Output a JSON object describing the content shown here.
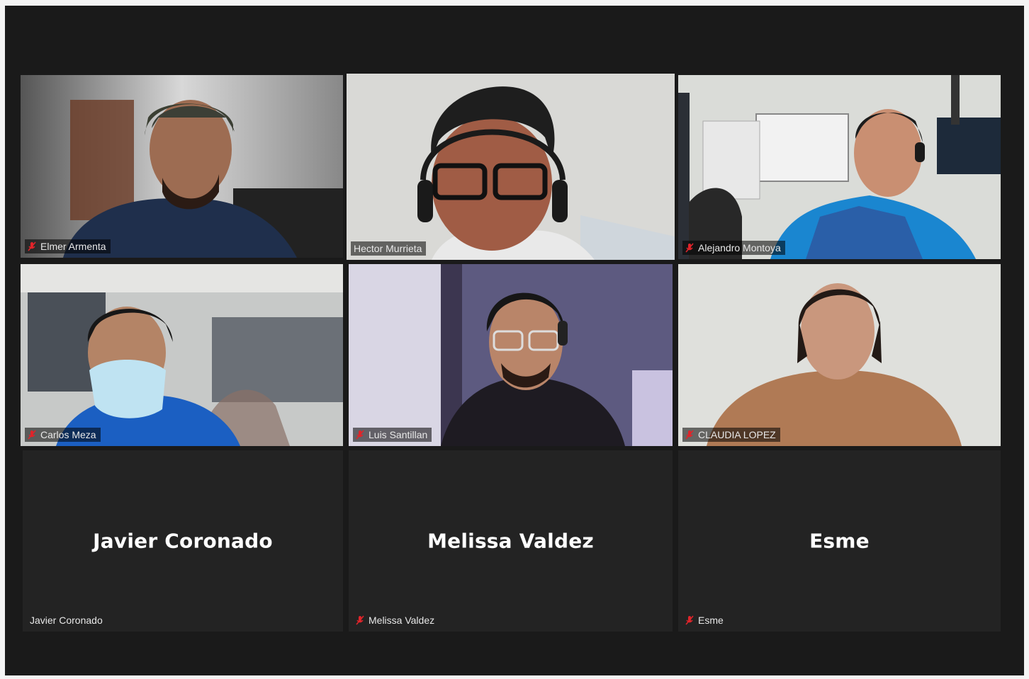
{
  "participants": [
    {
      "name": "Elmer Armenta",
      "video": true,
      "muted": true,
      "speaking": false
    },
    {
      "name": "Hector Murrieta",
      "video": true,
      "muted": false,
      "speaking": true
    },
    {
      "name": "Alejandro Montoya",
      "video": true,
      "muted": true,
      "speaking": false
    },
    {
      "name": "Carlos Meza",
      "video": true,
      "muted": true,
      "speaking": false
    },
    {
      "name": "Luis Santillan",
      "video": true,
      "muted": true,
      "speaking": false
    },
    {
      "name": "CLAUDIA LOPEZ",
      "video": true,
      "muted": true,
      "speaking": false
    },
    {
      "name": "Javier Coronado",
      "video": false,
      "muted": false,
      "speaking": false
    },
    {
      "name": "Melissa Valdez",
      "video": false,
      "muted": true,
      "speaking": false
    },
    {
      "name": "Esme",
      "video": false,
      "muted": true,
      "speaking": false
    }
  ],
  "colors": {
    "background": "#1a1a1a",
    "tile_off": "#232323",
    "active_speaker_border": "#d7e85a",
    "muted_icon": "#e0242a"
  },
  "icons": {
    "muted": "mic-muted-icon"
  }
}
